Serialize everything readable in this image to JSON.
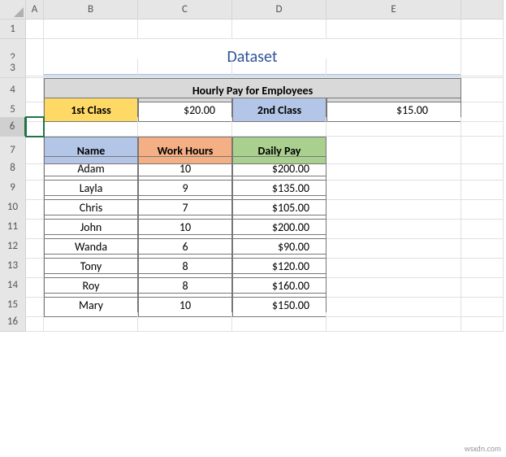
{
  "columns": [
    "A",
    "B",
    "C",
    "D",
    "E"
  ],
  "rows": [
    "1",
    "2",
    "3",
    "4",
    "5",
    "6",
    "7",
    "8",
    "9",
    "10",
    "11",
    "12",
    "13",
    "14",
    "15",
    "16"
  ],
  "title": "Dataset",
  "payHeader": "Hourly Pay for Employees",
  "class1Label": "1st Class",
  "class1Rate": "$20.00",
  "class2Label": "2nd Class",
  "class2Rate": "$15.00",
  "cols": {
    "name": "Name",
    "hours": "Work Hours",
    "pay": "Daily Pay"
  },
  "data": [
    {
      "name": "Adam",
      "hours": "10",
      "pay": "$200.00"
    },
    {
      "name": "Layla",
      "hours": "9",
      "pay": "$135.00"
    },
    {
      "name": "Chris",
      "hours": "7",
      "pay": "$105.00"
    },
    {
      "name": "John",
      "hours": "10",
      "pay": "$200.00"
    },
    {
      "name": "Wanda",
      "hours": "6",
      "pay": "$90.00"
    },
    {
      "name": "Tony",
      "hours": "8",
      "pay": "$120.00"
    },
    {
      "name": "Roy",
      "hours": "8",
      "pay": "$160.00"
    },
    {
      "name": "Mary",
      "hours": "10",
      "pay": "$150.00"
    }
  ],
  "watermark": "wsxdn.com"
}
